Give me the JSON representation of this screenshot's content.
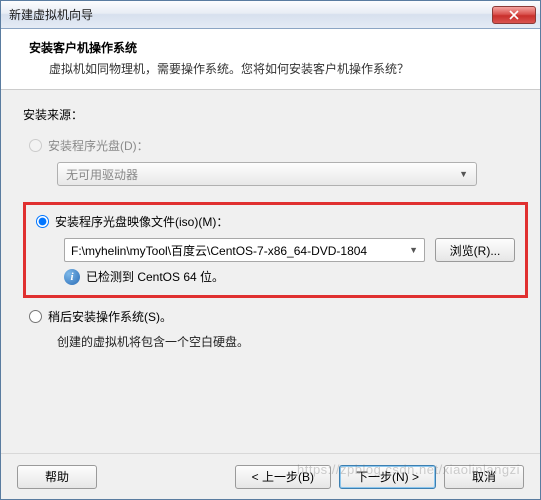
{
  "titlebar": {
    "text": "新建虚拟机向导"
  },
  "header": {
    "title": "安装客户机操作系统",
    "subtitle": "虚拟机如同物理机，需要操作系统。您将如何安装客户机操作系统？"
  },
  "source": {
    "label": "安装来源：",
    "disc": {
      "radio_label": "安装程序光盘(D)：",
      "dropdown": "无可用驱动器"
    },
    "iso": {
      "radio_label": "安装程序光盘映像文件(iso)(M)：",
      "path": "F:\\myhelin\\myTool\\百度云\\CentOS-7-x86_64-DVD-1804",
      "browse": "浏览(R)...",
      "info": "已检测到 CentOS 64 位。"
    },
    "later": {
      "radio_label": "稍后安装操作系统(S)。",
      "note": "创建的虚拟机将包含一个空白硬盘。"
    }
  },
  "footer": {
    "help": "帮助",
    "back": "< 上一步(B)",
    "next": "下一步(N) >",
    "cancel": "取消"
  },
  "watermark": "https://zpblog.csdn.net/xiaolinlangzi"
}
